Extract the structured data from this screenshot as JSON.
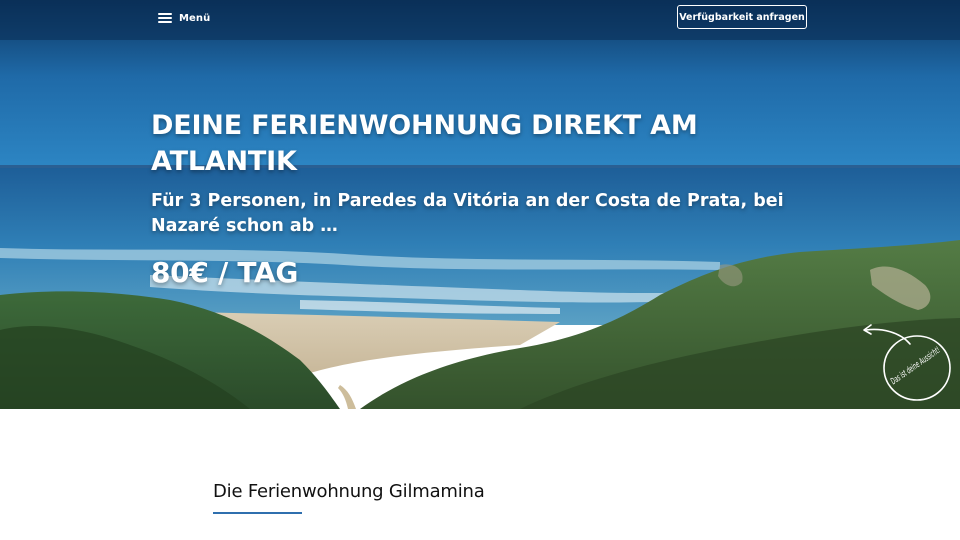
{
  "header": {
    "menu_label": "Menü",
    "cta_label": "Verfügbarkeit anfragen"
  },
  "hero": {
    "title": "DEINE FERIENWOHNUNG DIREKT AM ATLANTIK",
    "subtitle": "Für 3 Personen, in Paredes da Vitória an der Costa de Prata, bei Nazaré schon ab …",
    "price": "80€ / TAG",
    "stamp_text": "Das ist deine Aussicht!"
  },
  "section": {
    "title": "Die Ferienwohnung Gilmamina"
  },
  "colors": {
    "accent": "#2f6fae",
    "text_dark": "#111111",
    "white": "#ffffff"
  },
  "icons": {
    "menu": "hamburger-icon",
    "stamp_arrow": "curved-arrow-icon"
  }
}
